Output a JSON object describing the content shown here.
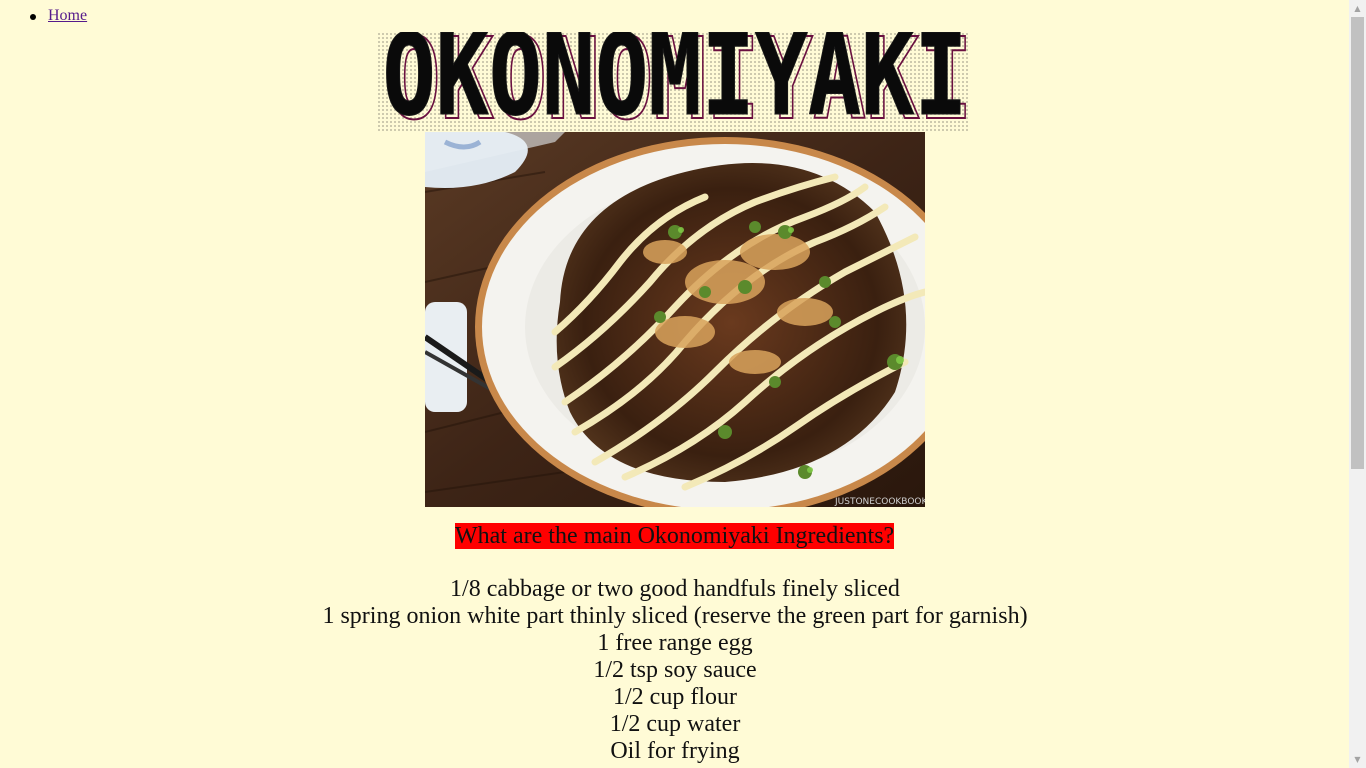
{
  "nav": {
    "home_label": "Home"
  },
  "header": {
    "title": "OKONOMIYAKI"
  },
  "image": {
    "watermark": "JUSTONECOOKBOOK"
  },
  "content": {
    "subheading": "What are the main Okonomiyaki Ingredients?",
    "ingredients": [
      "1/8 cabbage or two good handfuls finely sliced",
      "1 spring onion white part thinly sliced (reserve the green part for garnish)",
      "1 free range egg",
      "1/2 tsp soy sauce",
      "1/2 cup flour",
      "1/2 cup water",
      "Oil for frying"
    ]
  },
  "colors": {
    "background": "#fffbd6",
    "subheading_highlight": "#ff0000",
    "link": "#551a8b"
  },
  "icons": {
    "scroll_up": "arrow-up-icon",
    "scroll_down": "arrow-down-icon"
  }
}
